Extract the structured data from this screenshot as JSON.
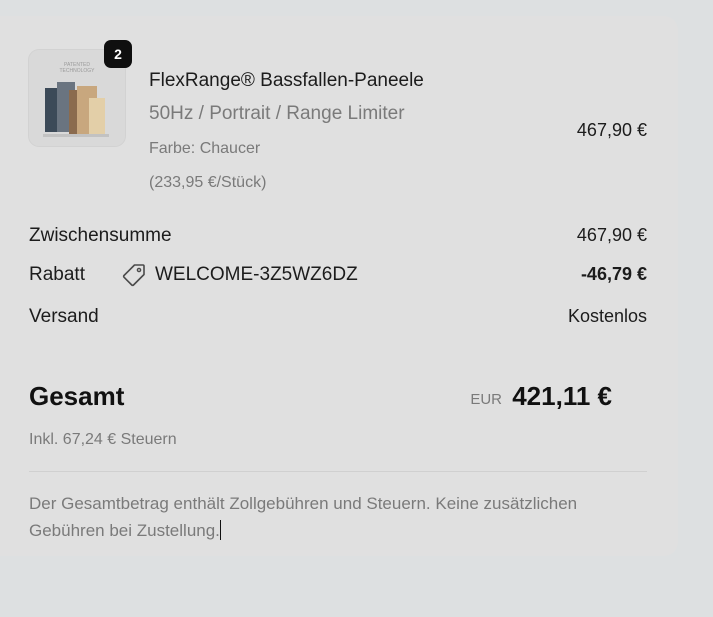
{
  "product": {
    "quantity": "2",
    "name": "FlexRange® Bassfallen-Paneele",
    "variant": "50Hz / Portrait / Range Limiter",
    "color": "Farbe: Chaucer",
    "unit_price": "(233,95 €/Stück)",
    "price": "467,90 €",
    "image_label_line1": "PATENTED",
    "image_label_line2": "TECHNOLOGY"
  },
  "summary": {
    "subtotal_label": "Zwischensumme",
    "subtotal_value": "467,90 €",
    "discount_label": "Rabatt",
    "discount_code": "WELCOME-3Z5WZ6DZ",
    "discount_value": "-46,79 €",
    "shipping_label": "Versand",
    "shipping_value": "Kostenlos",
    "total_label": "Gesamt",
    "currency": "EUR",
    "total_value": "421,11 €",
    "tax_note": "Inkl. 67,24 € Steuern",
    "footer_note": "Der Gesamtbetrag enthält Zollgebühren und Steuern. Keine zusätzlichen Gebühren bei Zustellung."
  },
  "icons": {
    "discount": "tag-icon"
  }
}
